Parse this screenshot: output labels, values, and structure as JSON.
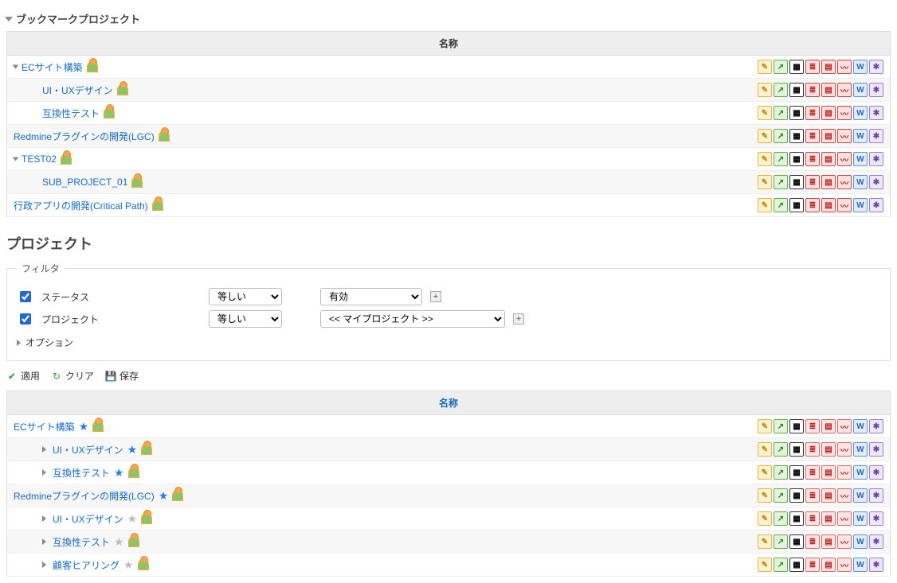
{
  "bookmark": {
    "title": "ブックマークプロジェクト",
    "columns": {
      "name": "名称"
    },
    "rows": [
      {
        "label": "ECサイト構築",
        "indent": 0,
        "expandable": true,
        "expanded": true
      },
      {
        "label": "UI・UXデザイン",
        "indent": 1
      },
      {
        "label": "互換性テスト",
        "indent": 1
      },
      {
        "label": "Redmineプラグインの開発(LGC)",
        "indent": 0
      },
      {
        "label": "TEST02",
        "indent": 0,
        "expandable": true,
        "expanded": true
      },
      {
        "label": "SUB_PROJECT_01",
        "indent": 1
      },
      {
        "label": "行政アプリの開発(Critical Path)",
        "indent": 0
      }
    ]
  },
  "projects": {
    "title": "プロジェクト",
    "filters": {
      "legend": "フィルタ",
      "status": {
        "label": "ステータス",
        "op": "等しい",
        "value": "有効"
      },
      "project": {
        "label": "プロジェクト",
        "op": "等しい",
        "value": "<< マイプロジェクト >>"
      }
    },
    "options_label": "オプション",
    "actions": {
      "apply": "適用",
      "clear": "クリア",
      "save": "保存"
    },
    "columns": {
      "name": "名称"
    },
    "rows": [
      {
        "label": "ECサイト構築",
        "indent": 0,
        "star": "blue"
      },
      {
        "label": "UI・UXデザイン",
        "indent": 1,
        "star": "blue",
        "expandable": true
      },
      {
        "label": "互換性テスト",
        "indent": 1,
        "star": "blue",
        "expandable": true
      },
      {
        "label": "Redmineプラグインの開発(LGC)",
        "indent": 0,
        "star": "blue"
      },
      {
        "label": "UI・UXデザイン",
        "indent": 1,
        "star": "gray",
        "expandable": true
      },
      {
        "label": "互換性テスト",
        "indent": 1,
        "star": "gray",
        "expandable": true
      },
      {
        "label": "顧客ヒアリング",
        "indent": 1,
        "star": "gray",
        "expandable": true
      }
    ]
  },
  "icons": {
    "edit": "✎",
    "activity": "↗",
    "calendar": "▦",
    "list": "≣",
    "table": "▤",
    "chart": "〰",
    "wiki": "W",
    "gear": "✱"
  }
}
